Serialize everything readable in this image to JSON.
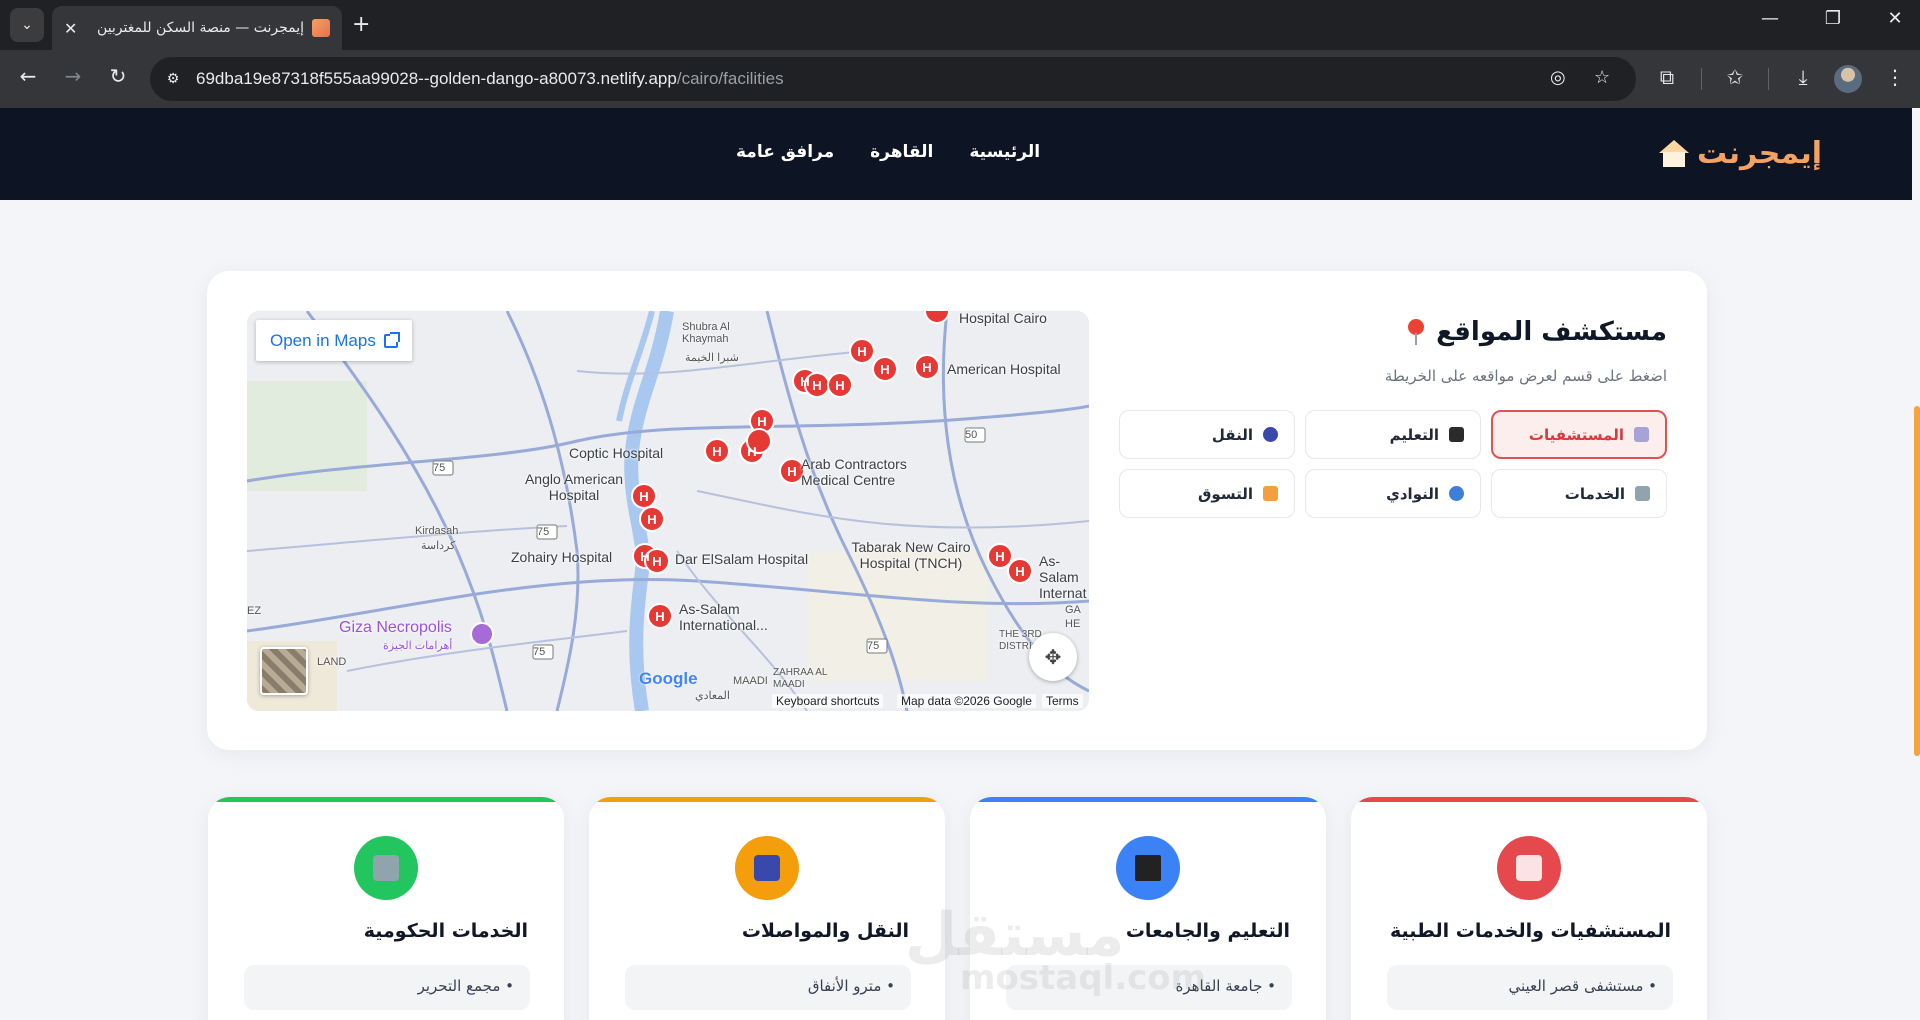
{
  "browser": {
    "tab_title": "إيمجرنت — منصة السكن للمغتربين",
    "url_host": "69dba19e87318f555aa99028--golden-dango-a80073.netlify.app",
    "url_path": "/cairo/facilities"
  },
  "site": {
    "logo": "إيمجرنت",
    "nav": [
      "الرئيسية",
      "القاهرة",
      "مرافق عامة"
    ]
  },
  "explorer": {
    "title": "مستكشف المواقع",
    "subtitle": "اضغط على قسم لعرض مواقعه على الخريطة",
    "categories": [
      {
        "label": "المستشفيات",
        "color": "#a7a3d6",
        "active": true
      },
      {
        "label": "التعليم",
        "color": "#2b2b2b",
        "active": false
      },
      {
        "label": "النقل",
        "color": "#3949ab",
        "active": false
      },
      {
        "label": "الخدمات",
        "color": "#90a4ae",
        "active": false
      },
      {
        "label": "النوادي",
        "color": "#3f7fd9",
        "active": false
      },
      {
        "label": "التسوق",
        "color": "#f2a03d",
        "active": false
      }
    ]
  },
  "map": {
    "open_in_maps": "Open in Maps",
    "labels": {
      "shubra": "Shubra Al Khaymah",
      "shubra_ar": "شبرا الخيمة",
      "hospital_cairo": "Hospital Cairo",
      "american_hospital": "American Hospital",
      "coptic_hospital": "Coptic Hospital",
      "arab_contractors": "Arab Contractors Medical Centre",
      "anglo_american": "Anglo American Hospital",
      "kirdasah": "Kirdasah",
      "kirdasah_ar": "كرداسة",
      "zohairy": "Zohairy Hospital",
      "dar_elsalam": "Dar ElSalam Hospital",
      "tabarak": "Tabarak New Cairo Hospital (TNCH)",
      "as_salam_intl_right": "As-Salam Internat",
      "giza_necropolis": "Giza Necropolis",
      "giza_necropolis_ar": "أهرامات الجيزة",
      "as_salam_intl": "As-Salam International...",
      "maadi": "MAADI",
      "maadi_ar": "المعادي",
      "zahraa_maadi": "ZAHRAA AL MAADI",
      "fifth_district": "THE 3RD DISTRICT",
      "road_75": "75",
      "road_50": "50",
      "edge_ez": "EZ",
      "edge_land": "LAND",
      "edge_ga": "GA HE"
    },
    "google": "Google",
    "attribution": [
      "Keyboard shortcuts",
      "Map data ©2026 Google",
      "Terms"
    ]
  },
  "cards": [
    {
      "title": "المستشفيات والخدمات الطبية",
      "item": "• مستشفى قصر العيني",
      "color": "#e5484d"
    },
    {
      "title": "التعليم والجامعات",
      "item": "• جامعة القاهرة",
      "color": "#3b82f6"
    },
    {
      "title": "النقل والمواصلات",
      "item": "• مترو الأنفاق",
      "color": "#f59e0b"
    },
    {
      "title": "الخدمات الحكومية",
      "item": "• مجمع التحرير",
      "color": "#22c55e"
    }
  ],
  "watermark": {
    "ar": "مستقل",
    "en": "mostaql.com"
  }
}
